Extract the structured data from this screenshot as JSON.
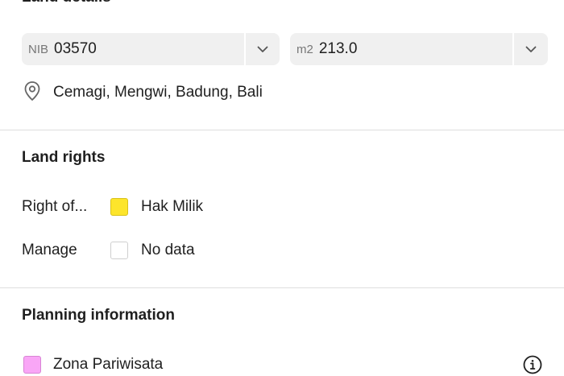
{
  "land_details": {
    "heading": "Land details",
    "nib_field": {
      "prefix": "NIB",
      "value": "03570"
    },
    "area_field": {
      "prefix": "m2",
      "value": "213.0"
    },
    "location": "Cemagi, Mengwi, Badung, Bali"
  },
  "land_rights": {
    "heading": "Land rights",
    "rows": [
      {
        "label": "Right of...",
        "value": "Hak Milik",
        "color": "#fde52b"
      },
      {
        "label": "Manage",
        "value": "No data",
        "color": "#ffffff"
      }
    ]
  },
  "planning": {
    "heading": "Planning information",
    "zone": {
      "value": "Zona Pariwisata",
      "color": "#f9a6f6"
    }
  },
  "icons": {
    "chevron": "chevron-down-icon",
    "location": "location-pin-icon",
    "info": "info-icon"
  }
}
